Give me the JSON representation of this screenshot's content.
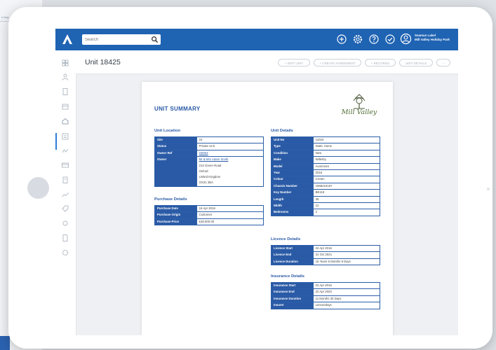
{
  "background": {
    "left_label": "e Day"
  },
  "colors": {
    "brand_blue": "#1f63b3",
    "table_header": "#2a5aa6",
    "logo_green": "#4f6b32"
  },
  "topbar": {
    "search_placeholder": "Search",
    "icons": [
      "add-circle-icon",
      "gear-icon",
      "help-icon",
      "check-circle-icon",
      "user-icon"
    ],
    "user_name": "Seamus Lakel",
    "user_org": "Mill Valley Holiday Park"
  },
  "sidebar": {
    "icons": [
      "dashboard-icon",
      "people-icon",
      "document-icon",
      "calendar-icon",
      "home-icon",
      "list-icon",
      "chart-icon",
      "card-icon",
      "clipboard-icon",
      "analytics-icon",
      "tag-icon",
      "settings-icon",
      "file-icon",
      "gear-icon"
    ]
  },
  "header": {
    "title": "Unit 18425",
    "buttons": [
      "+ EDIT UNIT",
      "+ CREATE AGREEMENT",
      "+ RECORDS",
      "UNIT DETAILS",
      "⋯"
    ]
  },
  "document": {
    "title": "UNIT SUMMARY",
    "brand_name": "Mill Valley",
    "unit_location": {
      "heading": "Unit Location",
      "rows": [
        {
          "label": "Site",
          "value": "24"
        },
        {
          "label": "Status",
          "value": "Private Unit"
        },
        {
          "label": "Owner Ref",
          "value": "O0003",
          "link": true
        },
        {
          "label": "Owner",
          "lines": [
            "Mr & Mrs Adam Smith",
            "213 Green Road",
            "Oxford",
            "United Kingdom",
            "OX31 2BA"
          ],
          "link_first": true
        }
      ]
    },
    "purchase_details": {
      "heading": "Purchase Details",
      "rows": [
        {
          "label": "Purchase Date",
          "value": "15 Apr 2016"
        },
        {
          "label": "Purchase Origin",
          "value": "Customer"
        },
        {
          "label": "Purchase Price",
          "value": "£28,000.00"
        }
      ]
    },
    "unit_details": {
      "heading": "Unit Details",
      "rows": [
        {
          "label": "Unit No",
          "value": "11023"
        },
        {
          "label": "Type",
          "value": "Static Home"
        },
        {
          "label": "Condition",
          "value": "New"
        },
        {
          "label": "Make",
          "value": "Willerby"
        },
        {
          "label": "Model",
          "value": "Avonmore"
        },
        {
          "label": "Year",
          "value": "2016"
        },
        {
          "label": "Colour",
          "value": "Cream"
        },
        {
          "label": "Chassis Number",
          "value": "1968224187"
        },
        {
          "label": "Key Number",
          "value": "BE119"
        },
        {
          "label": "Length",
          "value": "35"
        },
        {
          "label": "Width",
          "value": "12"
        },
        {
          "label": "Bedrooms",
          "value": "2"
        }
      ]
    },
    "licence_details": {
      "heading": "Licence Details",
      "rows": [
        {
          "label": "Licence Start",
          "value": "22 Apr 2016"
        },
        {
          "label": "Licence End",
          "value": "31 Oct 2021"
        },
        {
          "label": "Licence Duration",
          "value": "15 Years 6 Months 8 Days"
        }
      ]
    },
    "insurance_details": {
      "heading": "Insurance Details",
      "rows": [
        {
          "label": "Insurance Start",
          "value": "22 Apr 2016"
        },
        {
          "label": "Insurance End",
          "value": "22 Apr 2020"
        },
        {
          "label": "Insurance Duration",
          "value": "11 Months 30 Days"
        },
        {
          "label": "Insurer",
          "value": "Leisuredays"
        }
      ]
    }
  }
}
